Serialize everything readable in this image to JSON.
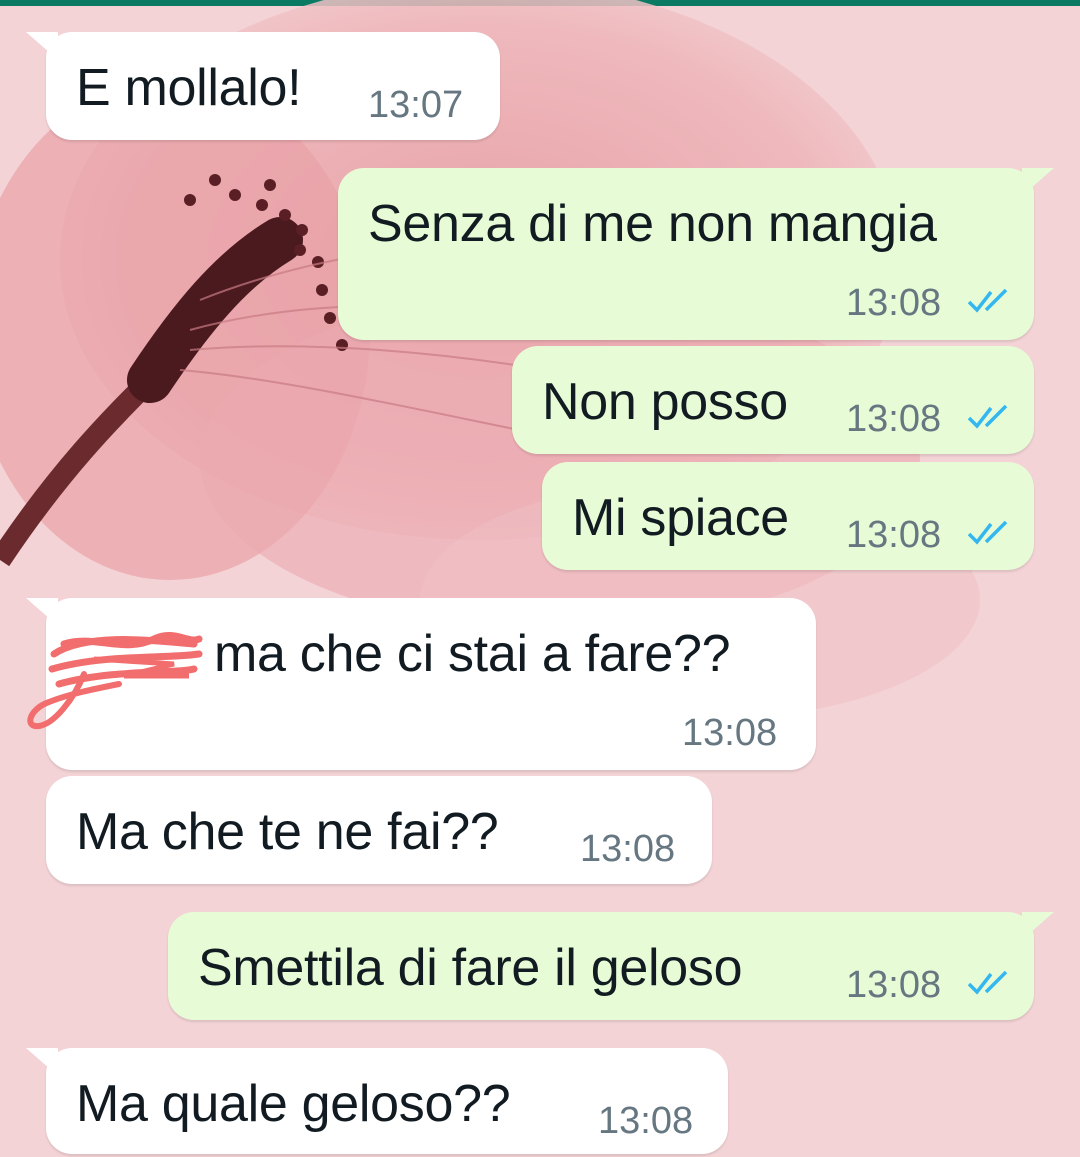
{
  "chat": {
    "messages": [
      {
        "direction": "incoming",
        "text": "E mollalo!",
        "time": "13:07"
      },
      {
        "direction": "outgoing",
        "text": "Senza di me non mangia",
        "time": "13:08",
        "status": "read"
      },
      {
        "direction": "outgoing",
        "text": "Non posso",
        "time": "13:08",
        "status": "read"
      },
      {
        "direction": "outgoing",
        "text": "Mi spiace",
        "time": "13:08",
        "status": "read"
      },
      {
        "direction": "incoming",
        "text": "ma che ci stai a fare??",
        "time": "13:08",
        "redacted_prefix": true
      },
      {
        "direction": "incoming",
        "text": "Ma che te ne fai??",
        "time": "13:08"
      },
      {
        "direction": "outgoing",
        "text": "Smettila di fare il geloso",
        "time": "13:08",
        "status": "read"
      },
      {
        "direction": "incoming",
        "text": "Ma quale geloso??",
        "time": "13:08"
      }
    ]
  },
  "colors": {
    "incoming_bubble": "#ffffff",
    "outgoing_bubble": "#e7fcd6",
    "read_ticks": "#34b7f1",
    "redaction": "#f26d6d",
    "header_accent": "#0b7a63"
  },
  "icons": {
    "read_status": "double-check-icon",
    "redaction": "scribble-redaction"
  }
}
